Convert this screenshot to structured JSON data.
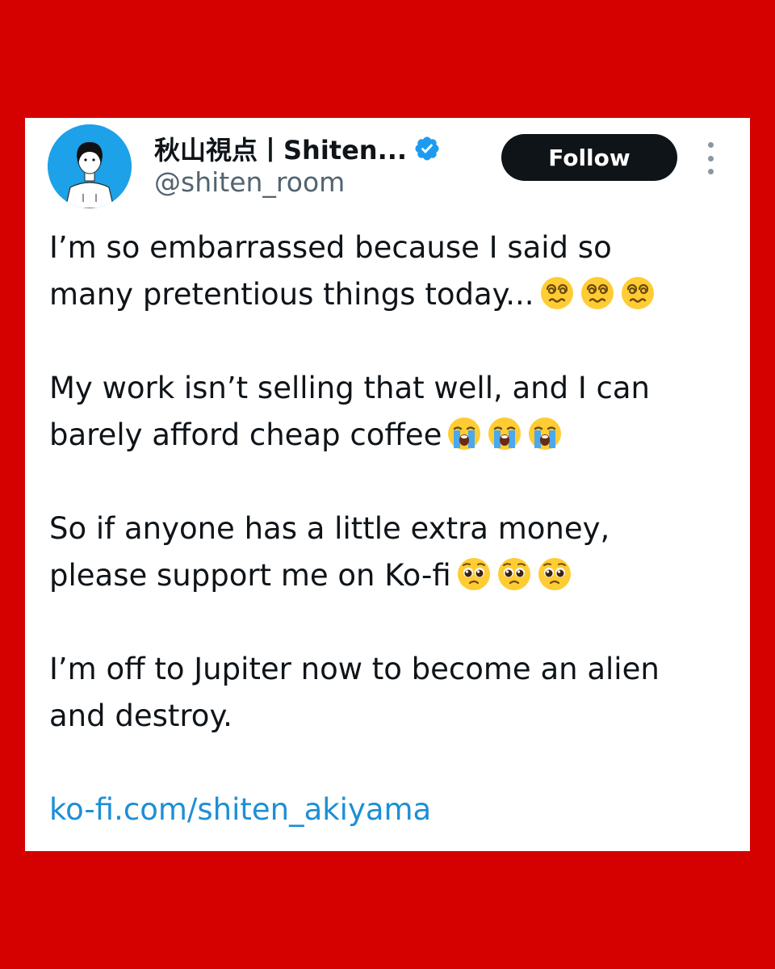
{
  "tweet": {
    "author": {
      "display_name": "秋山視点丨Shiten...",
      "handle": "@shiten_room",
      "verified": true
    },
    "follow_label": "Follow",
    "paragraphs": [
      {
        "lines": [
          "I’m so embarrassed because I said so",
          "many pretentious things today..."
        ],
        "emoji_name": "dizzy-face-emoji",
        "emoji_count": 3
      },
      {
        "lines": [
          "My work isn’t selling that well, and I can",
          "barely afford cheap coffee"
        ],
        "emoji_name": "loudly-crying-face-emoji",
        "emoji_count": 3
      },
      {
        "lines": [
          "So if anyone has a little extra money,",
          "please support me on Ko-fi"
        ],
        "emoji_name": "pleading-face-emoji",
        "emoji_count": 3
      },
      {
        "lines": [
          "I’m off to Jupiter now to become an alien",
          "and destroy."
        ]
      }
    ],
    "link": "ko-fi.com/shiten_akiyama"
  },
  "colors": {
    "background": "#d50000",
    "card": "#ffffff",
    "text": "#0f1419",
    "handle": "#536471",
    "link": "#1d8fd6",
    "verified": "#1d9bf0",
    "follow_button": "#0f1419"
  },
  "icons": {
    "verified": "verified-badge-icon",
    "more": "more-vertical-icon"
  }
}
